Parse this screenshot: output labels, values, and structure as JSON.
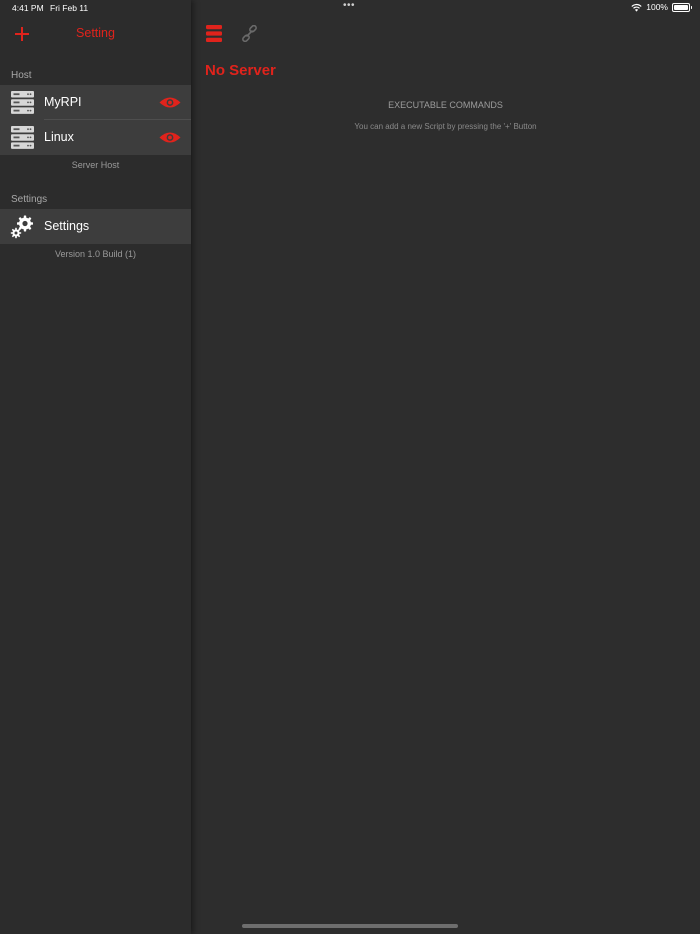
{
  "status": {
    "time": "4:41 PM",
    "date": "Fri Feb 11",
    "dots": "•••",
    "battery": "100%"
  },
  "sidebar": {
    "title": "Setting",
    "host_section": {
      "label": "Host",
      "items": [
        {
          "label": "MyRPI",
          "icon": "server-icon",
          "action_icon": "eye-icon"
        },
        {
          "label": "Linux",
          "icon": "server-icon",
          "action_icon": "eye-icon"
        }
      ],
      "footer": "Server Host"
    },
    "settings_section": {
      "label": "Settings",
      "items": [
        {
          "label": "Settings",
          "icon": "gear-icon"
        }
      ],
      "footer": "Version 1.0 Build (1)"
    }
  },
  "detail": {
    "title": "No Server",
    "toolbar_icons": [
      "list-icon",
      "link-icon"
    ],
    "commands_title": "EXECUTABLE COMMANDS",
    "commands_hint": "You can add a new Script by pressing the '+' Button"
  },
  "colors": {
    "accent": "#e0231c",
    "background": "#2d2d2d",
    "row": "#3d3d3d"
  }
}
